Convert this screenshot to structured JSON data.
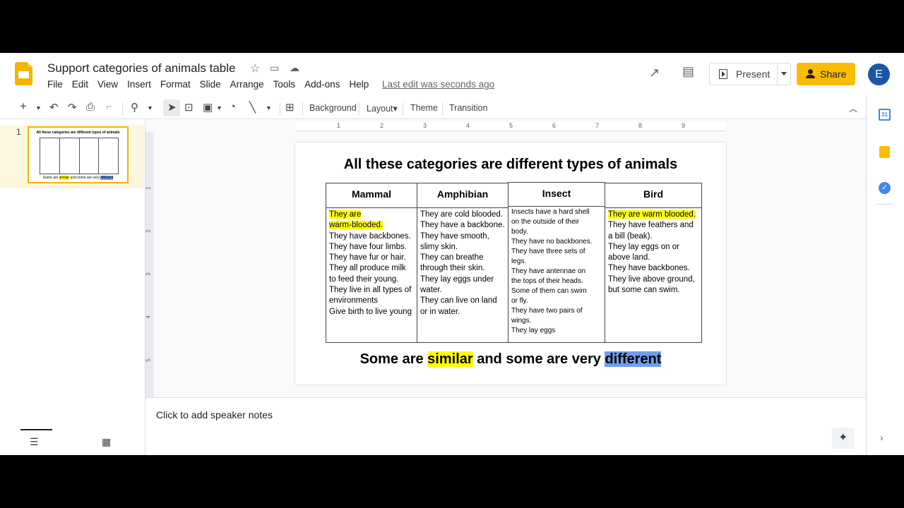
{
  "header": {
    "title": "Support categories of animals table",
    "menu": [
      "File",
      "Edit",
      "View",
      "Insert",
      "Format",
      "Slide",
      "Arrange",
      "Tools",
      "Add-ons",
      "Help"
    ],
    "last_edit": "Last edit was seconds ago",
    "present_label": "Present",
    "share_label": "Share",
    "avatar_letter": "E"
  },
  "toolbar": {
    "background": "Background",
    "layout": "Layout▾",
    "theme": "Theme",
    "transition": "Transition"
  },
  "filmstrip": {
    "slide_number": "1"
  },
  "rulers": {
    "horizontal": [
      "1",
      "2",
      "3",
      "4",
      "5",
      "6",
      "7",
      "8",
      "9"
    ],
    "vertical": [
      "1",
      "2",
      "3",
      "4",
      "5"
    ]
  },
  "slide": {
    "title": "All these categories are different types of animals",
    "columns": [
      {
        "header": "Mammal",
        "lines": [
          "They are",
          "warm-blooded.",
          "They have backbones.",
          "They have four limbs.",
          "They have fur or hair.",
          "They all produce milk",
          "to feed their young.",
          "They live in all types of",
          "environments",
          "Give birth to live young"
        ]
      },
      {
        "header": "Amphibian",
        "lines": [
          "They are cold blooded.",
          "They have a backbone.",
          "They have smooth,",
          "slimy skin.",
          "They can breathe",
          "through their skin.",
          "They lay eggs under",
          "water.",
          "They can live on land",
          "or in water."
        ]
      },
      {
        "header": "Insect",
        "lines": [
          "Insects have a hard shell",
          "on the outside of their",
          "body.",
          "They have no backbones.",
          "They have three sets of",
          "legs.",
          "They have antennae on",
          "the tops of their heads.",
          "Some of them can swim",
          "or fly.",
          "They have two pairs of",
          "wings.",
          "They lay eggs"
        ]
      },
      {
        "header": "Bird",
        "lines": [
          "They are warm blooded.",
          "They have feathers and",
          "a bill (beak).",
          "They lay eggs on or",
          "above land.",
          "They have backbones.",
          "They live above ground,",
          "but some can swim."
        ]
      }
    ],
    "bottom": {
      "part1": "Some are ",
      "similar": "similar",
      "part2": " and some are very ",
      "different": "different"
    }
  },
  "notes": {
    "placeholder": "Click to add speaker notes"
  },
  "colors": {
    "highlight_yellow": "#ffff00",
    "highlight_blue": "#6d9eeb",
    "share_button": "#fbbc04",
    "slides_logo": "#f4b400"
  }
}
